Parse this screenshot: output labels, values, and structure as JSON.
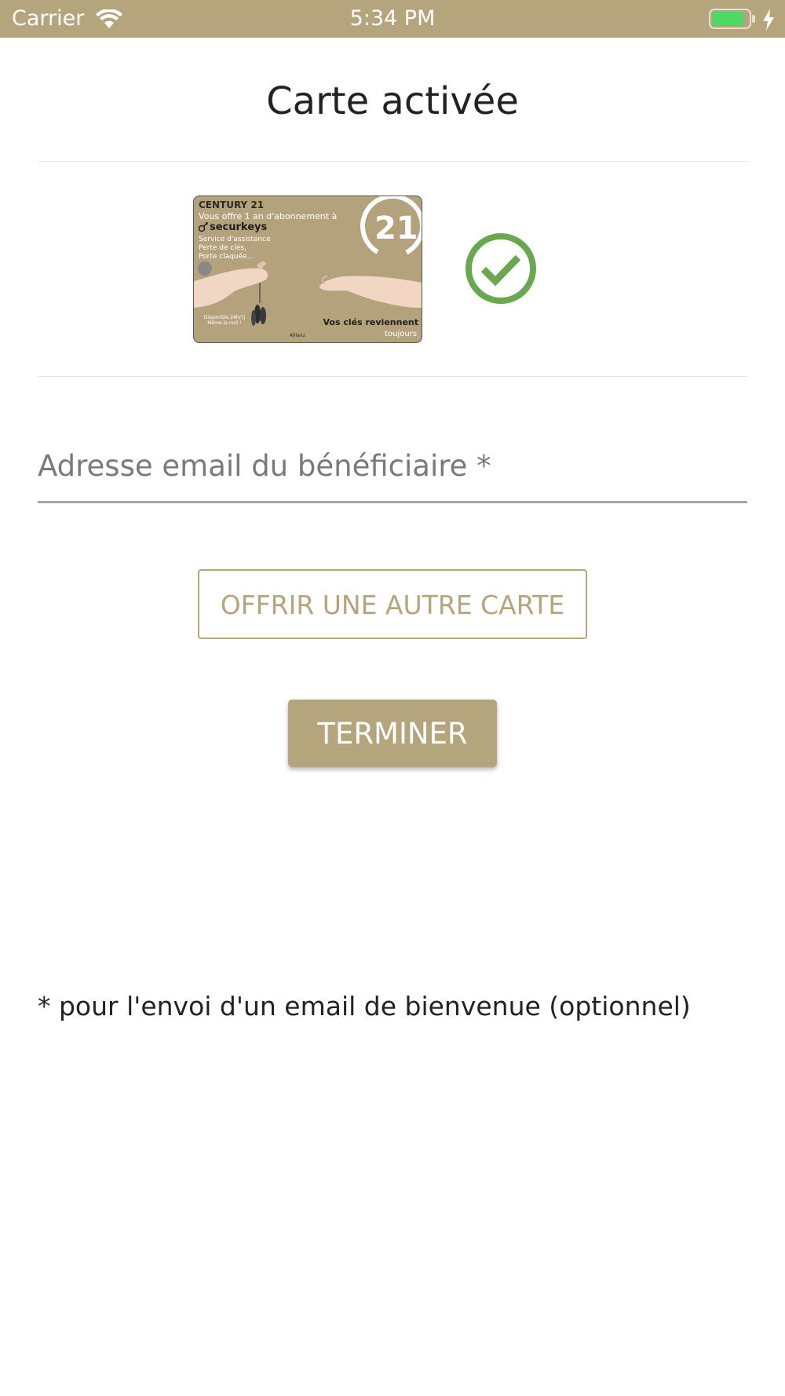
{
  "status_bar": {
    "carrier": "Carrier",
    "time": "5:34 PM",
    "battery_color": "#4cd964",
    "icons": [
      "wifi-icon",
      "battery-icon",
      "charging-bolt-icon"
    ]
  },
  "header": {
    "title": "Carte activée"
  },
  "card": {
    "brand": "CENTURY 21",
    "offer": "Vous offre 1 an d'abonnement à",
    "product": "securkeys",
    "services": [
      "Service d'assistance",
      "Perte de clés,",
      "Porte claquée..."
    ],
    "availability": [
      "Disponible 24h/7j",
      "Même la nuit !"
    ],
    "tagline": "Vos clés reviennent",
    "tagline_2": "toujours",
    "insurer": "Allianz",
    "logo_text": "21"
  },
  "status": {
    "icon": "check-circle-icon",
    "color": "#6aa84f"
  },
  "form": {
    "email_placeholder": "Adresse email du bénéficiaire *",
    "email_value": ""
  },
  "actions": {
    "offer_another_label": "OFFRIR UNE AUTRE CARTE",
    "finish_label": "TERMINER"
  },
  "footnote": "* pour l'envoi d'un email de bienvenue (optionnel)",
  "colors": {
    "accent": "#b5a57c",
    "success": "#6aa84f"
  }
}
